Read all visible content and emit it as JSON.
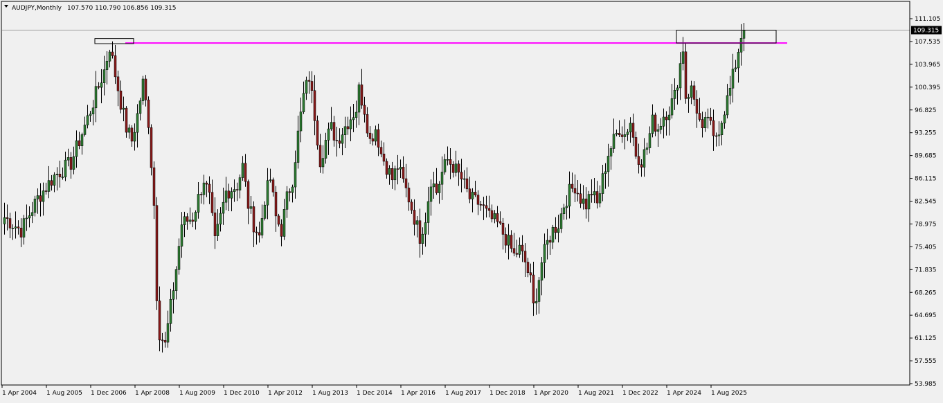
{
  "header": {
    "symbol_label": "AUDJPY,Monthly",
    "ohlc": "107.570 110.790 106.856 109.315",
    "menu_icon": "triangle-down-icon"
  },
  "chart_data": {
    "type": "candlestick",
    "title": "AUDJPY,Monthly",
    "ylim": [
      53.985,
      111.105
    ],
    "y_ticks": [
      "111.105",
      "107.535",
      "103.965",
      "100.395",
      "96.825",
      "93.255",
      "89.685",
      "86.115",
      "82.545",
      "78.975",
      "75.405",
      "71.835",
      "68.265",
      "64.695",
      "61.125",
      "57.555",
      "53.985"
    ],
    "x_ticks": [
      "1 Apr 2004",
      "1 Aug 2005",
      "1 Dec 2006",
      "1 Apr 2008",
      "1 Aug 2009",
      "1 Dec 2010",
      "1 Apr 2012",
      "1 Aug 2013",
      "1 Dec 2014",
      "1 Apr 2016",
      "1 Aug 2017",
      "1 Dec 2018",
      "1 Apr 2020",
      "1 Aug 2021",
      "1 Dec 2022",
      "1 Apr 2024",
      "1 Aug 2025"
    ],
    "last_price": "109.315",
    "last_price_line": 109.315,
    "resistance_level": 107.3,
    "colors": {
      "background": "#f0f0f0",
      "bull": "#2e7d32",
      "bear": "#8b1a1a",
      "wick": "#000000",
      "resistance": "#ff00ff",
      "grid_line": "#808080",
      "price_tag_bg": "#000000",
      "price_tag_text": "#ffffff"
    },
    "boxes": [
      {
        "from_index": 33,
        "to_index": 47,
        "low": 107.2,
        "high": 108.0
      },
      {
        "from_index": 243,
        "to_index": 279,
        "low": 107.3,
        "high": 109.3
      }
    ],
    "price_anchors": [
      [
        0,
        80.0
      ],
      [
        6,
        78.0
      ],
      [
        12,
        83.0
      ],
      [
        18,
        86.5
      ],
      [
        24,
        88.5
      ],
      [
        30,
        95.5
      ],
      [
        36,
        103.0
      ],
      [
        38,
        106.8
      ],
      [
        42,
        98.0
      ],
      [
        44,
        94.0
      ],
      [
        46,
        92.0
      ],
      [
        48,
        96.0
      ],
      [
        50,
        101.0
      ],
      [
        52,
        95.0
      ],
      [
        54,
        82.0
      ],
      [
        55,
        68.0
      ],
      [
        56,
        62.0
      ],
      [
        58,
        60.0
      ],
      [
        60,
        66.0
      ],
      [
        62,
        72.0
      ],
      [
        64,
        79.0
      ],
      [
        68,
        80.0
      ],
      [
        72,
        86.0
      ],
      [
        74,
        83.0
      ],
      [
        76,
        76.0
      ],
      [
        78,
        80.0
      ],
      [
        80,
        84.0
      ],
      [
        84,
        85.0
      ],
      [
        86,
        88.0
      ],
      [
        88,
        82.0
      ],
      [
        90,
        79.0
      ],
      [
        92,
        77.0
      ],
      [
        94,
        83.0
      ],
      [
        96,
        86.0
      ],
      [
        98,
        80.0
      ],
      [
        100,
        78.0
      ],
      [
        102,
        83.0
      ],
      [
        104,
        86.0
      ],
      [
        106,
        93.0
      ],
      [
        108,
        99.0
      ],
      [
        110,
        102.0
      ],
      [
        112,
        96.0
      ],
      [
        114,
        89.0
      ],
      [
        116,
        92.0
      ],
      [
        118,
        94.0
      ],
      [
        120,
        92.0
      ],
      [
        124,
        95.0
      ],
      [
        127,
        97.0
      ],
      [
        128,
        100.0
      ],
      [
        130,
        97.0
      ],
      [
        132,
        92.0
      ],
      [
        134,
        94.0
      ],
      [
        136,
        90.0
      ],
      [
        138,
        88.0
      ],
      [
        140,
        86.0
      ],
      [
        142,
        88.0
      ],
      [
        146,
        83.0
      ],
      [
        148,
        80.0
      ],
      [
        150,
        77.0
      ],
      [
        152,
        80.0
      ],
      [
        154,
        86.0
      ],
      [
        156,
        84.0
      ],
      [
        158,
        87.0
      ],
      [
        160,
        89.0
      ],
      [
        162,
        88.0
      ],
      [
        165,
        86.0
      ],
      [
        168,
        83.0
      ],
      [
        172,
        82.0
      ],
      [
        175,
        80.0
      ],
      [
        178,
        79.0
      ],
      [
        182,
        76.0
      ],
      [
        184,
        74.0
      ],
      [
        186,
        75.0
      ],
      [
        188,
        73.0
      ],
      [
        190,
        70.0
      ],
      [
        191,
        66.0
      ],
      [
        192,
        68.0
      ],
      [
        194,
        73.0
      ],
      [
        196,
        76.0
      ],
      [
        198,
        78.0
      ],
      [
        200,
        79.0
      ],
      [
        202,
        82.0
      ],
      [
        204,
        84.0
      ],
      [
        206,
        85.0
      ],
      [
        208,
        83.0
      ],
      [
        210,
        82.0
      ],
      [
        212,
        84.0
      ],
      [
        214,
        82.0
      ],
      [
        216,
        86.0
      ],
      [
        218,
        90.0
      ],
      [
        220,
        92.0
      ],
      [
        222,
        94.0
      ],
      [
        224,
        93.0
      ],
      [
        226,
        95.0
      ],
      [
        228,
        90.0
      ],
      [
        230,
        89.0
      ],
      [
        232,
        91.0
      ],
      [
        234,
        95.0
      ],
      [
        236,
        94.0
      ],
      [
        238,
        96.0
      ],
      [
        240,
        97.0
      ],
      [
        242,
        99.0
      ],
      [
        244,
        104.0
      ],
      [
        245,
        106.5
      ],
      [
        246,
        99.0
      ],
      [
        248,
        100.0
      ],
      [
        250,
        97.0
      ],
      [
        252,
        93.0
      ],
      [
        254,
        96.0
      ],
      [
        256,
        92.0
      ],
      [
        258,
        94.0
      ],
      [
        260,
        97.0
      ],
      [
        262,
        100.0
      ],
      [
        264,
        104.0
      ],
      [
        266,
        108.5
      ],
      [
        267,
        109.3
      ]
    ],
    "candle_count": 268
  }
}
